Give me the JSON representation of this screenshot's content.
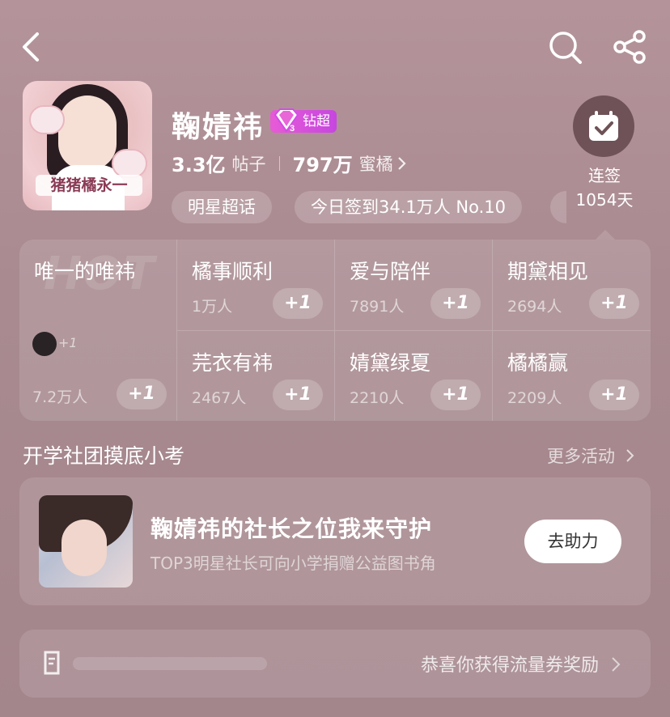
{
  "header": {
    "name": "鞠婧祎",
    "badge": "钻超",
    "posts_count": "3.3亿",
    "posts_label": "帖子",
    "fans_count": "797万",
    "fans_label": "蜜橘",
    "avatar_banner": "猪猪橘永一"
  },
  "tags": [
    {
      "label": "明星超话"
    },
    {
      "label": "今日签到34.1万人 No.10"
    }
  ],
  "checkin": {
    "label": "连签",
    "days": "1054天"
  },
  "hot_grid": {
    "watermark": "HOT",
    "main": {
      "title": "唯一的唯祎",
      "count": "7.2万人",
      "mini_plus": "+1",
      "plus": "+1"
    },
    "cells": [
      {
        "title": "橘事顺利",
        "count": "1万人",
        "plus": "+1"
      },
      {
        "title": "爱与陪伴",
        "count": "7891人",
        "plus": "+1"
      },
      {
        "title": "期黛相见",
        "count": "2694人",
        "plus": "+1"
      },
      {
        "title": "芫衣有祎",
        "count": "2467人",
        "plus": "+1"
      },
      {
        "title": "婧黛绿夏",
        "count": "2210人",
        "plus": "+1"
      },
      {
        "title": "橘橘赢",
        "count": "2209人",
        "plus": "+1"
      }
    ]
  },
  "section": {
    "title": "开学社团摸底小考",
    "more": "更多活动"
  },
  "activity_card": {
    "title": "鞠婧祎的社长之位我来守护",
    "subtitle": "TOP3明星社长可向小学捐赠公益图书角",
    "button": "去助力"
  },
  "bottom_bar": {
    "text": "恭喜你获得流量券奖励"
  }
}
